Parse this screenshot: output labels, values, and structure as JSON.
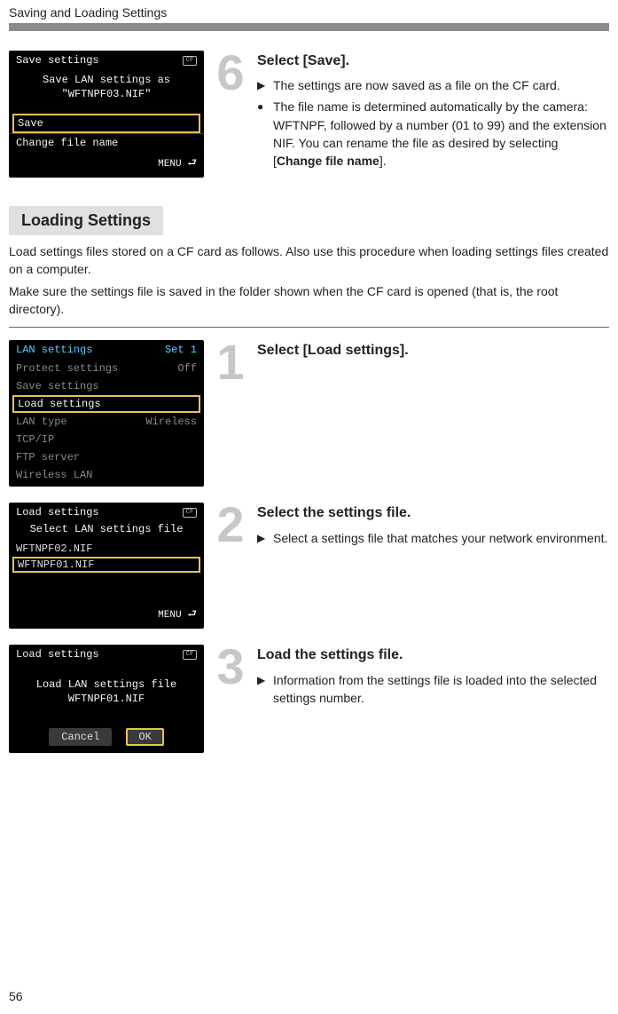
{
  "header": "Saving and Loading Settings",
  "page_number": "56",
  "step6": {
    "number": "6",
    "title": "Select [Save].",
    "bullets": [
      {
        "mark": "▶",
        "text": "The settings are now saved as a file on the CF card."
      },
      {
        "mark": "●",
        "text_before": "The file name is determined automatically by the camera: WFTNPF, followed by a number (01 to 99) and the extension NIF. You can rename the file as desired by selecting [",
        "bold": "Change file name",
        "text_after": "]."
      }
    ],
    "screen": {
      "title": "Save settings",
      "line1": "Save LAN settings as",
      "line2": "\"WFTNPF03.NIF\"",
      "opt_selected": "Save",
      "opt2": "Change file name",
      "footer": "MENU"
    }
  },
  "loading_section": {
    "heading": "Loading Settings",
    "para1": "Load settings files stored on a CF card as follows. Also use this procedure when loading settings files created on a computer.",
    "para2": "Make sure the settings file is saved in the folder shown when the CF card is opened (that is, the root directory)."
  },
  "step1": {
    "number": "1",
    "title": "Select [Load settings].",
    "screen": {
      "header_left": "LAN settings",
      "header_right": "Set 1",
      "rows": [
        {
          "left": "Protect settings",
          "right": "Off",
          "dim": true
        },
        {
          "left": "Save settings",
          "right": "",
          "dim": true
        },
        {
          "left": "Load settings",
          "right": "",
          "selected": true
        },
        {
          "left": "LAN type",
          "right": "Wireless",
          "dim": true
        },
        {
          "left": "TCP/IP",
          "right": "",
          "dim": true
        },
        {
          "left": "FTP server",
          "right": "",
          "dim": true
        },
        {
          "left": "Wireless LAN",
          "right": "",
          "dim": true
        }
      ]
    }
  },
  "step2": {
    "number": "2",
    "title": "Select the settings file.",
    "bullets": [
      {
        "mark": "▶",
        "text": "Select a settings file that matches your network environment."
      }
    ],
    "screen": {
      "title": "Load settings",
      "subtitle": "Select LAN settings file",
      "files": [
        {
          "name": "WFTNPF02.NIF"
        },
        {
          "name": "WFTNPF01.NIF",
          "selected": true
        }
      ],
      "footer": "MENU"
    }
  },
  "step3": {
    "number": "3",
    "title": "Load the settings file.",
    "bullets": [
      {
        "mark": "▶",
        "text": "Information from the settings file is loaded into the selected settings number."
      }
    ],
    "screen": {
      "title": "Load settings",
      "line1": "Load LAN settings file",
      "line2": "WFTNPF01.NIF",
      "btn_cancel": "Cancel",
      "btn_ok": "OK"
    }
  }
}
